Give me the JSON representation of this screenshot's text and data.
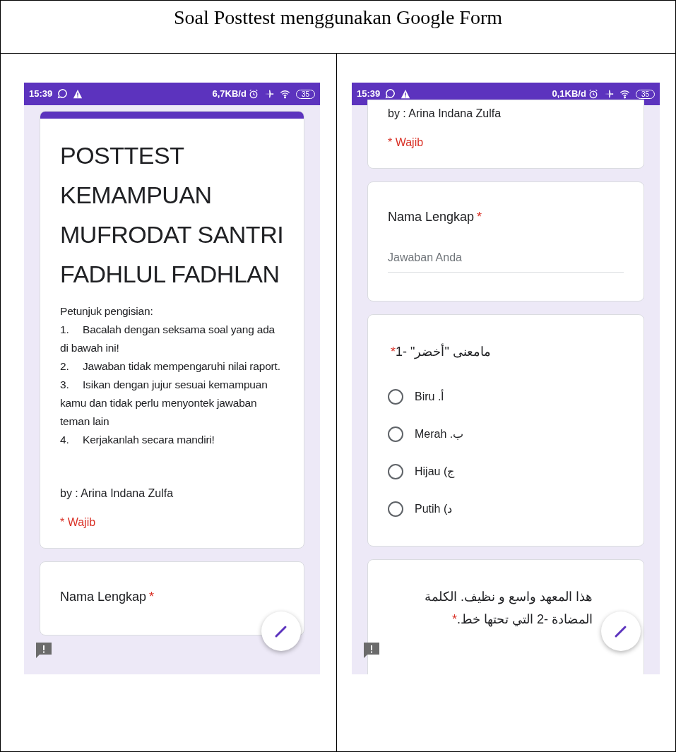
{
  "document_title": "Soal Posttest menggunakan Google Form",
  "screens": [
    {
      "status_bar": {
        "time": "15:39",
        "speed": "6,7KB/d",
        "battery": "35"
      },
      "cards": [
        {
          "kind": "header",
          "title": "POSTTEST KEMAMPUAN MUFRODAT SANTRI FADHLUL FADHLAN",
          "intro": "Petunjuk pengisian:",
          "instructions": [
            {
              "number": "1.",
              "text": "Bacalah dengan seksama soal yang ada di bawah ini!"
            },
            {
              "number": "2.",
              "text": "Jawaban tidak mempengaruhi nilai raport."
            },
            {
              "number": "3.",
              "text": "Isikan dengan jujur sesuai kemampuan kamu dan tidak perlu menyontek jawaban teman lain"
            },
            {
              "number": "4.",
              "text": "Kerjakanlah secara mandiri!"
            }
          ],
          "author": "by : Arina Indana Zulfa",
          "required_note": "* Wajib"
        },
        {
          "kind": "text",
          "question": "Nama Lengkap",
          "required_mark": "*"
        }
      ]
    },
    {
      "status_bar": {
        "time": "15:39",
        "speed": "0,1KB/d",
        "battery": "35"
      },
      "cards": [
        {
          "kind": "header",
          "author": "by : Arina Indana Zulfa",
          "required_note": "* Wajib"
        },
        {
          "kind": "text",
          "question": "Nama Lengkap",
          "required_mark": "*",
          "placeholder": "Jawaban Anda"
        },
        {
          "kind": "choice",
          "question": "مامعنى \"أخضر\" -1",
          "required_mark": "*",
          "options": [
            {
              "label": "أ. Biru",
              "selected": false
            },
            {
              "label": "ب. Merah",
              "selected": false
            },
            {
              "label": "ج) Hijau",
              "selected": false
            },
            {
              "label": "د) Putih",
              "selected": false
            }
          ]
        },
        {
          "kind": "choice",
          "question": "هذا المعهد واسع و نظيف. الكلمة المضادة -2 التي تحتها خط.",
          "required_mark": "*"
        }
      ]
    }
  ]
}
